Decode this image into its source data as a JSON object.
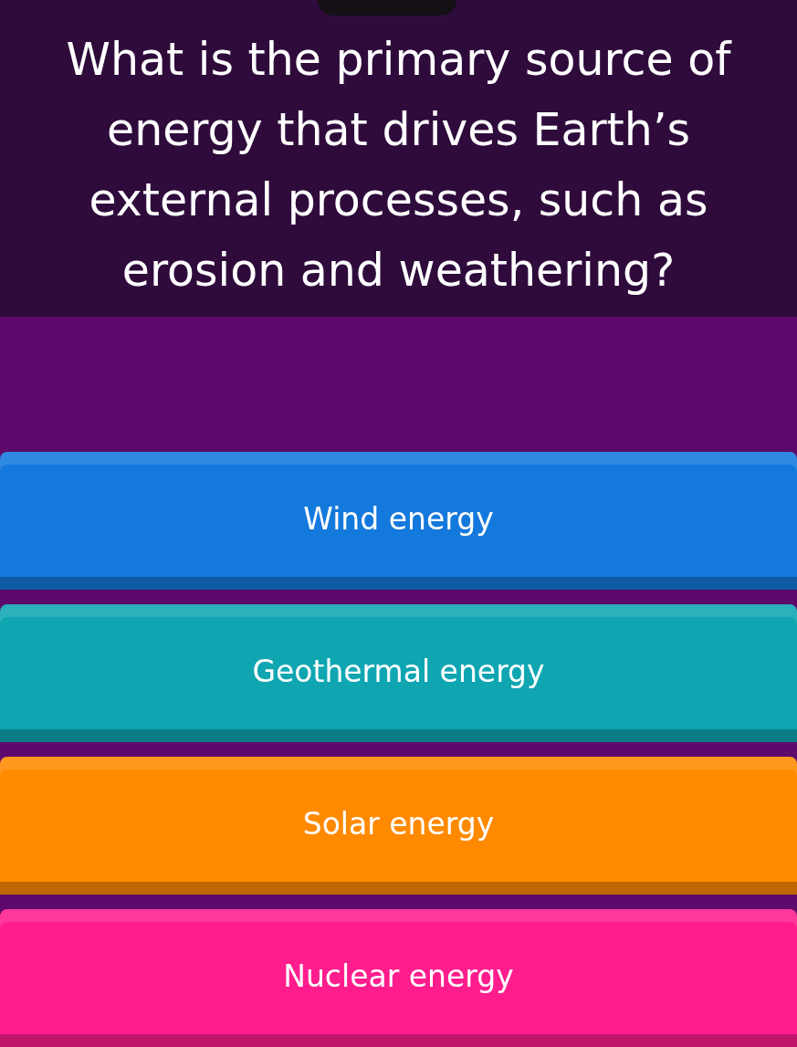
{
  "question": "What is the primary source of energy that drives Earth’s external processes, such as erosion and weathering?",
  "answers": [
    {
      "label": "Wind energy",
      "color": "#1479dc"
    },
    {
      "label": "Geothermal energy",
      "color": "#0fa6b2"
    },
    {
      "label": "Solar energy",
      "color": "#ff8a00"
    },
    {
      "label": "Nuclear energy",
      "color": "#ff1d8e"
    }
  ]
}
